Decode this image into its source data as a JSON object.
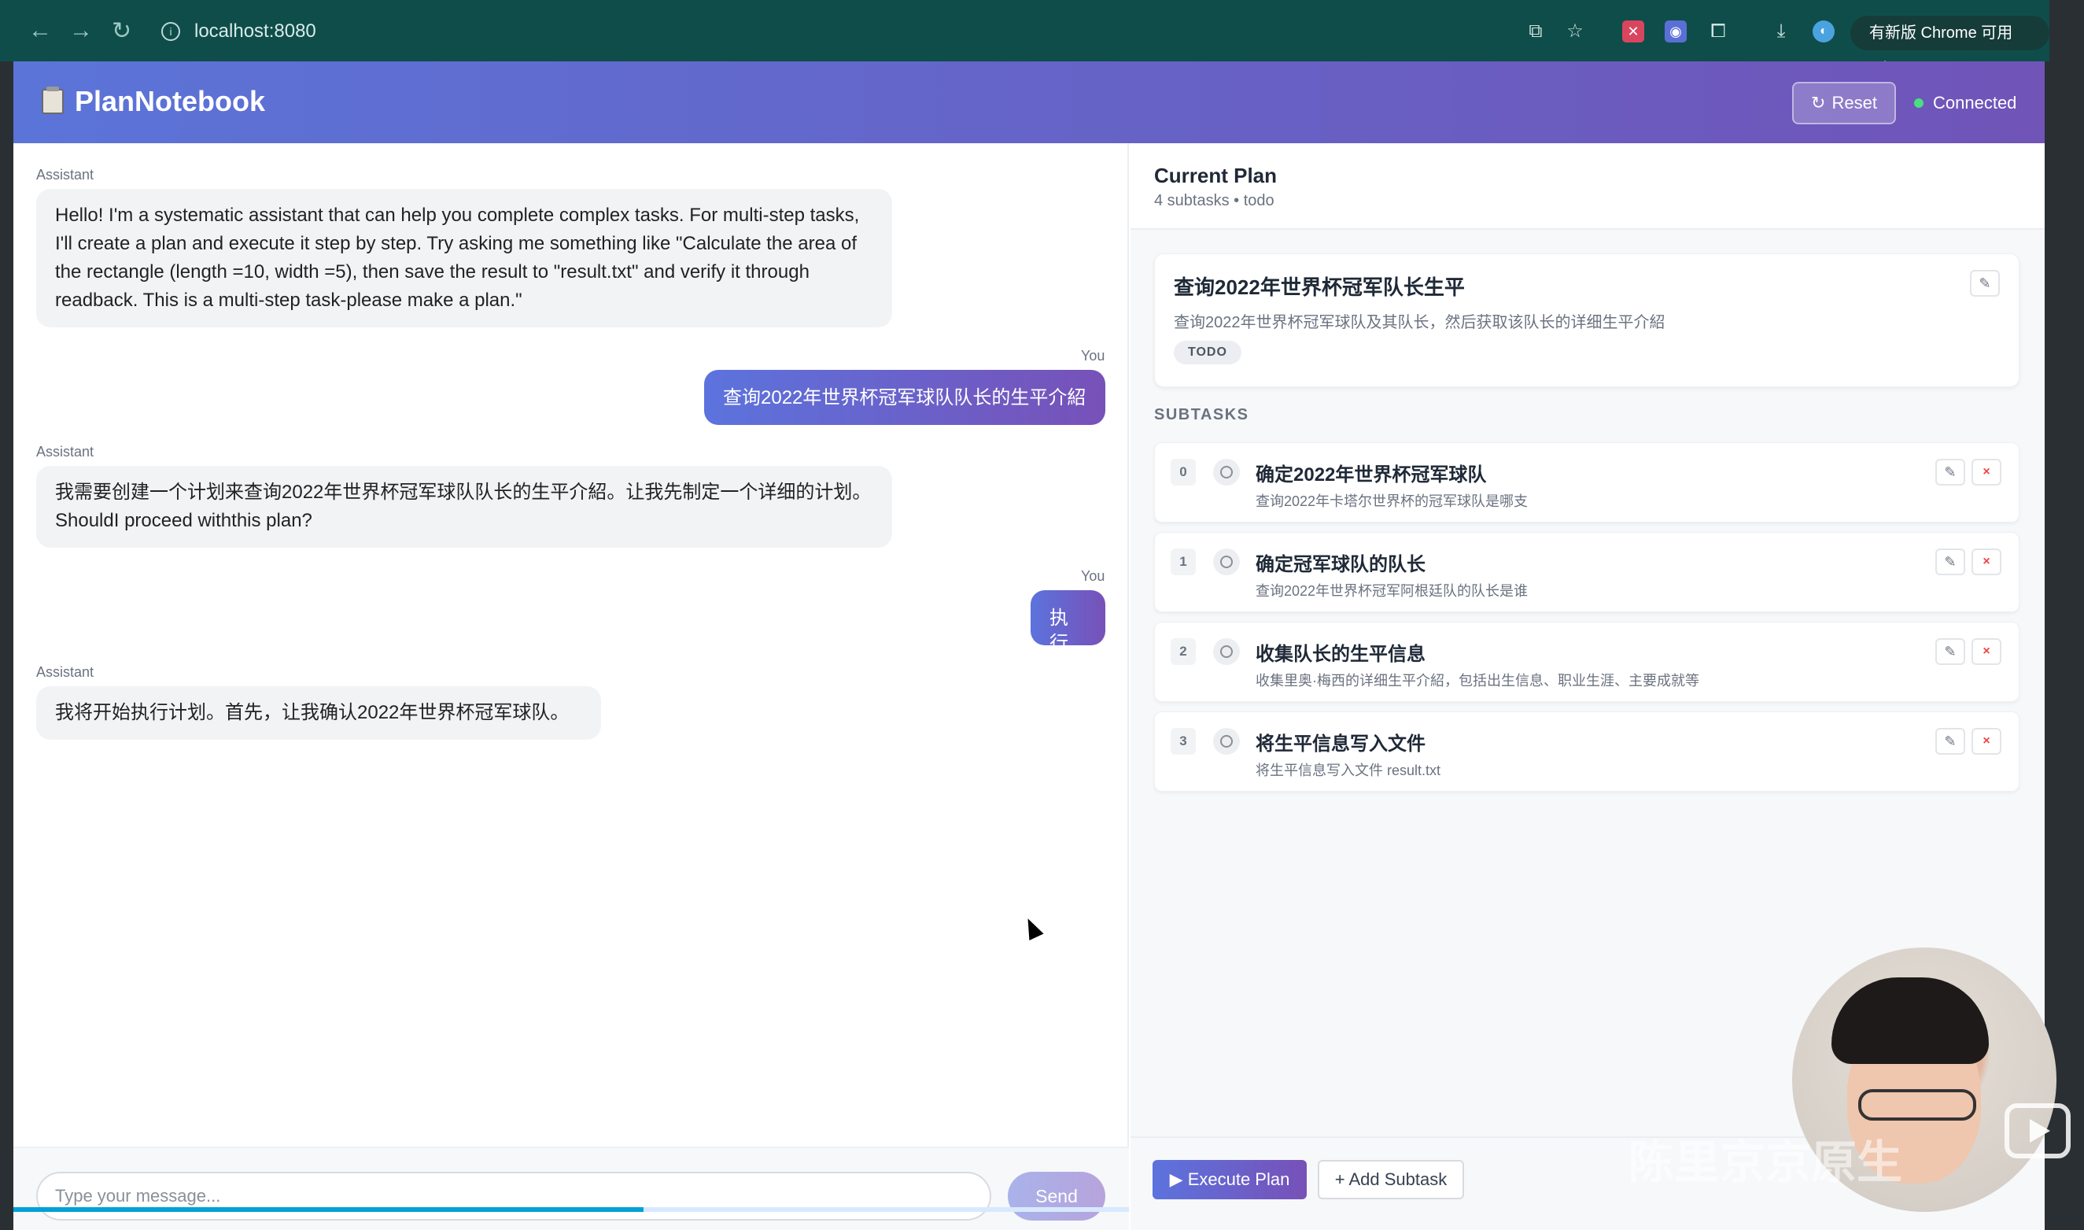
{
  "browser": {
    "url": "localhost:8080",
    "update_label": "有新版 Chrome 可用",
    "icons": [
      "back-icon",
      "forward-icon",
      "reload-icon",
      "site-info-icon",
      "translate-icon",
      "star-icon",
      "extension-icon",
      "puzzle-icon",
      "download-icon",
      "profile-icon",
      "more-icon"
    ]
  },
  "app": {
    "title": "PlanNotebook",
    "reset_label": "Reset",
    "status": "Connected",
    "status_color": "#4ade80"
  },
  "chat": {
    "messages": [
      {
        "role": "Assistant",
        "text": "Hello! I'm a systematic assistant that can help you complete complex tasks. For multi-step tasks, I'll create a plan and execute it step by step. Try asking me something like \"Calculate the area of the rectangle (length =10, width =5), then save the result to \"result.txt\" and verify it through readback. This is a multi-step task-please make a plan.\""
      },
      {
        "role": "You",
        "text": "查询2022年世界杯冠军球队队长的生平介紹"
      },
      {
        "role": "Assistant",
        "text": "我需要创建一个计划来查询2022年世界杯冠军球队队长的生平介紹。让我先制定一个详细的计划。ShouldI proceed withthis plan?"
      },
      {
        "role": "You",
        "text": "执行"
      },
      {
        "role": "Assistant",
        "text": "我将开始执行计划。首先，让我确认2022年世界杯冠军球队。"
      }
    ],
    "input_placeholder": "Type your message...",
    "send_label": "Send",
    "video_progress": 0.565
  },
  "plan": {
    "heading": "Current Plan",
    "summary": "4 subtasks • todo",
    "main_task": {
      "title": "查询2022年世界杯冠军队长生平",
      "description": "查询2022年世界杯冠军球队及其队长，然后获取该队长的详细生平介紹",
      "status": "TODO"
    },
    "subtasks_label": "SUBTASKS",
    "subtasks": [
      {
        "index": "0",
        "title": "确定2022年世界杯冠军球队",
        "description": "查询2022年卡塔尔世界杯的冠军球队是哪支"
      },
      {
        "index": "1",
        "title": "确定冠军球队的队长",
        "description": "查询2022年世界杯冠军阿根廷队的队长是谁"
      },
      {
        "index": "2",
        "title": "收集队长的生平信息",
        "description": "收集里奥·梅西的详细生平介紹，包括出生信息、职业生涯、主要成就等"
      },
      {
        "index": "3",
        "title": "将生平信息写入文件",
        "description": "将生平信息写入文件 result.txt"
      }
    ],
    "execute_label": "▶ Execute Plan",
    "add_label": "+ Add Subtask"
  },
  "overlay": {
    "watermark": "陈里京京原生"
  }
}
